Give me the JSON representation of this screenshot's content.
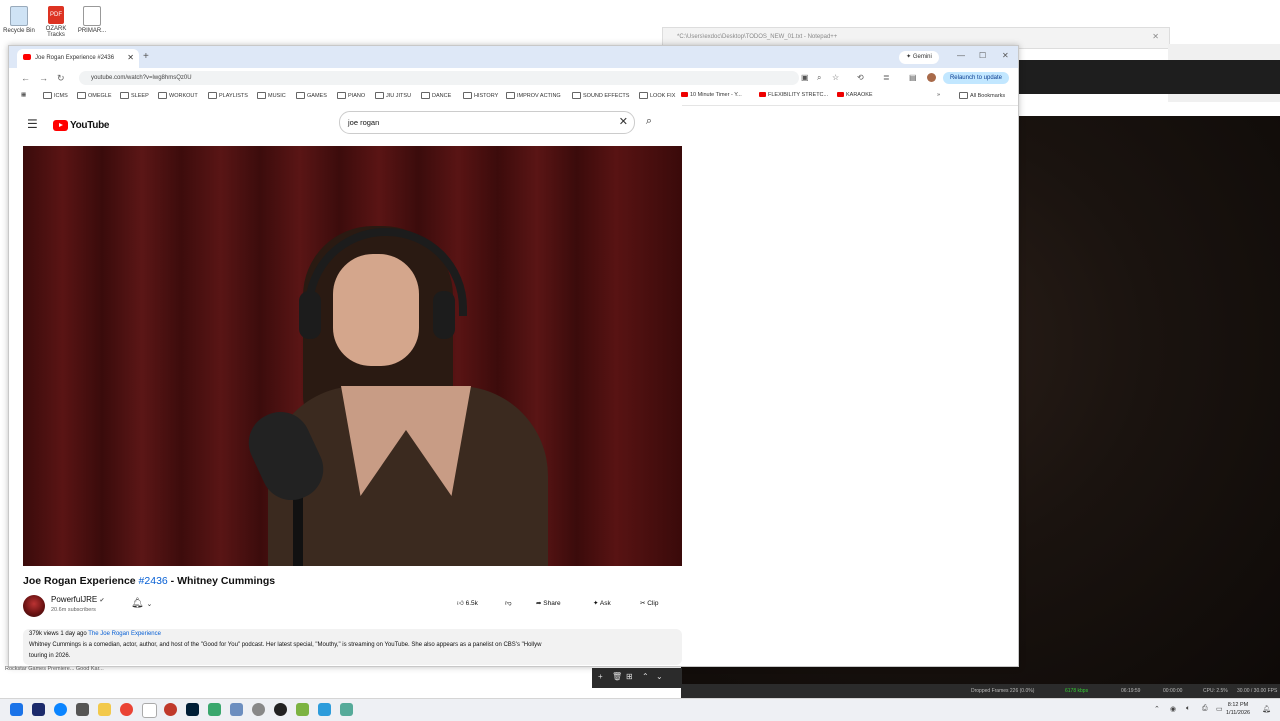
{
  "desktop": {
    "icons": [
      {
        "label": "Recycle Bin"
      },
      {
        "label": "OZARK Tracks"
      },
      {
        "label": "PRIMAR..."
      }
    ],
    "bottom_icons_text": "Rockstar Games    Premiere...   Good Kar..."
  },
  "notepad": {
    "title": "*C:\\Users\\exdoc\\Desktop\\TODOS_NEW_01.txt - Notepad++"
  },
  "chrome": {
    "tab_title": "Joe Rogan Experience #2436",
    "new_tab_symbol": "+",
    "gemini_label": "Gemini",
    "url": "youtube.com/watch?v=lwg8hmsQz0U",
    "relaunch_label": "Relaunch to update",
    "bookmarks": [
      {
        "label": "ICMS",
        "kind": "folder"
      },
      {
        "label": "OMEGLE",
        "kind": "folder"
      },
      {
        "label": "SLEEP",
        "kind": "folder"
      },
      {
        "label": "WORKOUT",
        "kind": "folder"
      },
      {
        "label": "PLAYLISTS",
        "kind": "folder"
      },
      {
        "label": "MUSIC",
        "kind": "folder"
      },
      {
        "label": "GAMES",
        "kind": "folder"
      },
      {
        "label": "PIANO",
        "kind": "folder"
      },
      {
        "label": "JIU JITSU",
        "kind": "folder"
      },
      {
        "label": "DANCE",
        "kind": "folder"
      },
      {
        "label": "HISTORY",
        "kind": "folder"
      },
      {
        "label": "IMPROV ACTING",
        "kind": "folder"
      },
      {
        "label": "SOUND EFFECTS",
        "kind": "folder"
      },
      {
        "label": "LOOK FIX",
        "kind": "folder"
      },
      {
        "label": "10 Minute Timer - Y...",
        "kind": "yt"
      },
      {
        "label": "FLEXIBILITY STRETC...",
        "kind": "yt"
      },
      {
        "label": "KARAOKE",
        "kind": "yt"
      }
    ],
    "all_bookmarks": "All Bookmarks"
  },
  "youtube": {
    "logo_text": "YouTube",
    "search_value": "joe rogan",
    "video_title_prefix": "Joe Rogan Experience ",
    "video_title_tag": "#2436",
    "video_title_suffix": " - Whitney Cummings",
    "channel_name": "PowerfulJRE",
    "subscribers": "20.6m subscribers",
    "likes": "6.5k",
    "share_label": "Share",
    "ask_label": "Ask",
    "clip_label": "Clip",
    "views_date": "379k views  1 day ago",
    "desc_channel": "The Joe Rogan Experience",
    "desc_line2": "Whitney Cummings is a comedian, actor, author, and host of the \"Good for You\" podcast. Her latest special, \"Mouthy,\" is streaming on YouTube. She also appears as a panelist on CBS's \"Hollyw",
    "desc_line3": "touring in 2026."
  },
  "obs": {
    "dropped_frames": "Dropped Frames 226 (0.0%)",
    "bitrate": "6178 kbps",
    "rec_time": "06:19:59",
    "stream_time": "00:00:00",
    "cpu": "CPU: 2.5%",
    "fps": "30.00 / 30.00 FPS"
  },
  "taskbar": {
    "time": "8:12 PM",
    "date": "1/11/2026"
  },
  "colors": {
    "youtube_red": "#ff0000",
    "link_blue": "#065fd4",
    "chrome_frame": "#dee8f7"
  }
}
